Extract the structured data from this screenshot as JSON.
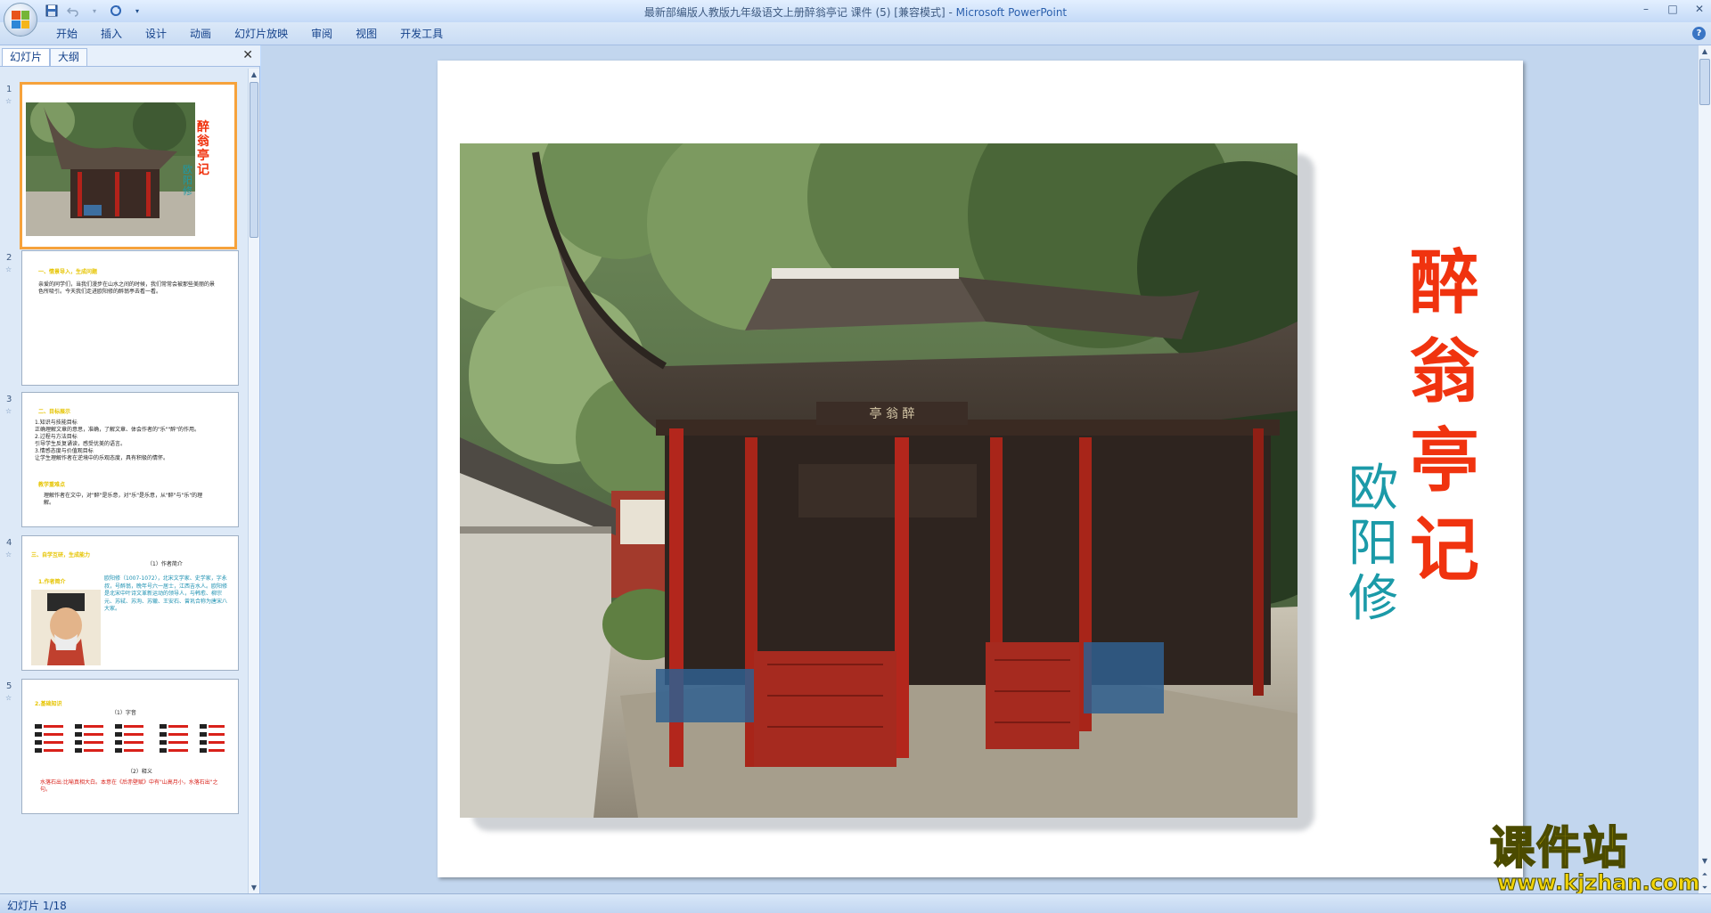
{
  "window": {
    "title": "最新部编版人教版九年级语文上册醉翁亭记 课件 (5) [兼容模式]",
    "app_name": "Microsoft PowerPoint",
    "separator": " - "
  },
  "ribbon": {
    "tabs": [
      "开始",
      "插入",
      "设计",
      "动画",
      "幻灯片放映",
      "审阅",
      "视图",
      "开发工具"
    ],
    "help": "?"
  },
  "panel": {
    "tabs": [
      "幻灯片",
      "大纲"
    ],
    "close": "✕"
  },
  "thumbnails": [
    {
      "num": "1",
      "title": "醉翁亭记",
      "author": "欧阳修"
    },
    {
      "num": "2",
      "heading": "一、情景导入，生成问题",
      "body": "亲爱的同学们，当我们漫步在山水之间的时候，我们常常会被那些美丽的景色所吸引。今天我们走进欧阳修的醉翁亭去看一看。"
    },
    {
      "num": "3",
      "heading": "二、目标展示",
      "lines": [
        "1.知识与技能目标",
        "正确理解文章的意思，准确，了解文章、体会作者的\"乐\"\"醉\"的作用。",
        "2.过程与方法目标",
        "引导学生反复诵读，感受优美的语言。",
        "3.情感态度与价值观目标",
        "让学生理解作者在逆境中的乐观态度，具有积极的情怀。"
      ],
      "sub": "教学重难点",
      "sub_body": "理解作者在文中，对\"醉\"是乐意，对\"乐\"是乐意，从\"醉\"与\"乐\"的理解。"
    },
    {
      "num": "4",
      "heading": "三、自学互研，生成能力",
      "sub": "（1）作者简介",
      "label": "1.作者简介",
      "body": "欧阳修（1007-1072），北宋文学家、史学家，字永叔，号醉翁，晚年号六一居士，江西吉水人。欧阳修是北宋中叶诗文革新运动的领导人，与韩愈、柳宗元、苏轼、苏洵、苏辙、王安石、曾巩合称为唐宋八大家。"
    },
    {
      "num": "5",
      "heading": "2.基础知识",
      "sub": "（1）字音",
      "sub2": "（2）释义",
      "body": "水落石出:比喻真相大白。本意在《后赤壁赋》中有\"山高月小，水落石出\"之句。"
    }
  ],
  "slide": {
    "title": "醉翁亭记",
    "author": "欧阳修"
  },
  "status": {
    "slide_info": "幻灯片 1/18"
  },
  "watermark": {
    "text": "课件站",
    "url": "www.kjzhan.com"
  },
  "colors": {
    "title_red": "#f0330f",
    "author_teal": "#1b9aa8",
    "selected_border": "#f6a23b"
  }
}
